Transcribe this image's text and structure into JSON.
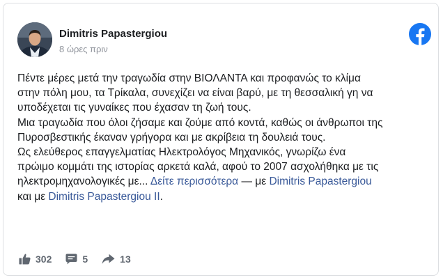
{
  "post": {
    "author": "Dimitris Papastergiou",
    "timestamp": "8 ώρες πριν",
    "body_lines": [
      "Πέντε μέρες μετά την τραγωδία στην ΒΙΟΛΑΝΤΑ και προφανώς το κλίμα",
      "στην πόλη μου, τα Τρίκαλα, συνεχίζει να είναι βαρύ, με τη θεσσαλική γη να",
      "υποδέχεται τις γυναίκες που έχασαν τη ζωή τους.",
      "Μια τραγωδία που όλοι ζήσαμε και ζούμε από κοντά, καθώς οι άνθρωποι της",
      "Πυροσβεστικής έκαναν γρήγορα και με ακρίβεια τη δουλειά τους.",
      "Ως ελεύθερος επαγγελματίας Ηλεκτρολόγος Μηχανικός, γνωρίζω ένα",
      "πρώιμο κομμάτι της ιστορίας αρκετά καλά, αφού το 2007 ασχολήθηκα με τις"
    ],
    "last_line_text": "ηλεκτρομηχανολογικές με...",
    "see_more": "Δείτε περισσότερα",
    "tag_separator": " — με ",
    "tagged_1": "Dimitris Papastergiou",
    "and_word": "και με ",
    "tagged_2": "Dimitris Papastergiou II",
    "tag_end": "."
  },
  "stats": {
    "likes": "302",
    "comments": "5",
    "shares": "13"
  },
  "icons": {
    "logo": "facebook-logo-icon",
    "like": "thumbs-up-icon",
    "comment": "comment-icon",
    "share": "share-icon"
  },
  "colors": {
    "brand": "#1877f2",
    "link": "#385898",
    "text": "#1c1e21",
    "muted": "#90949c",
    "action": "#606770"
  }
}
